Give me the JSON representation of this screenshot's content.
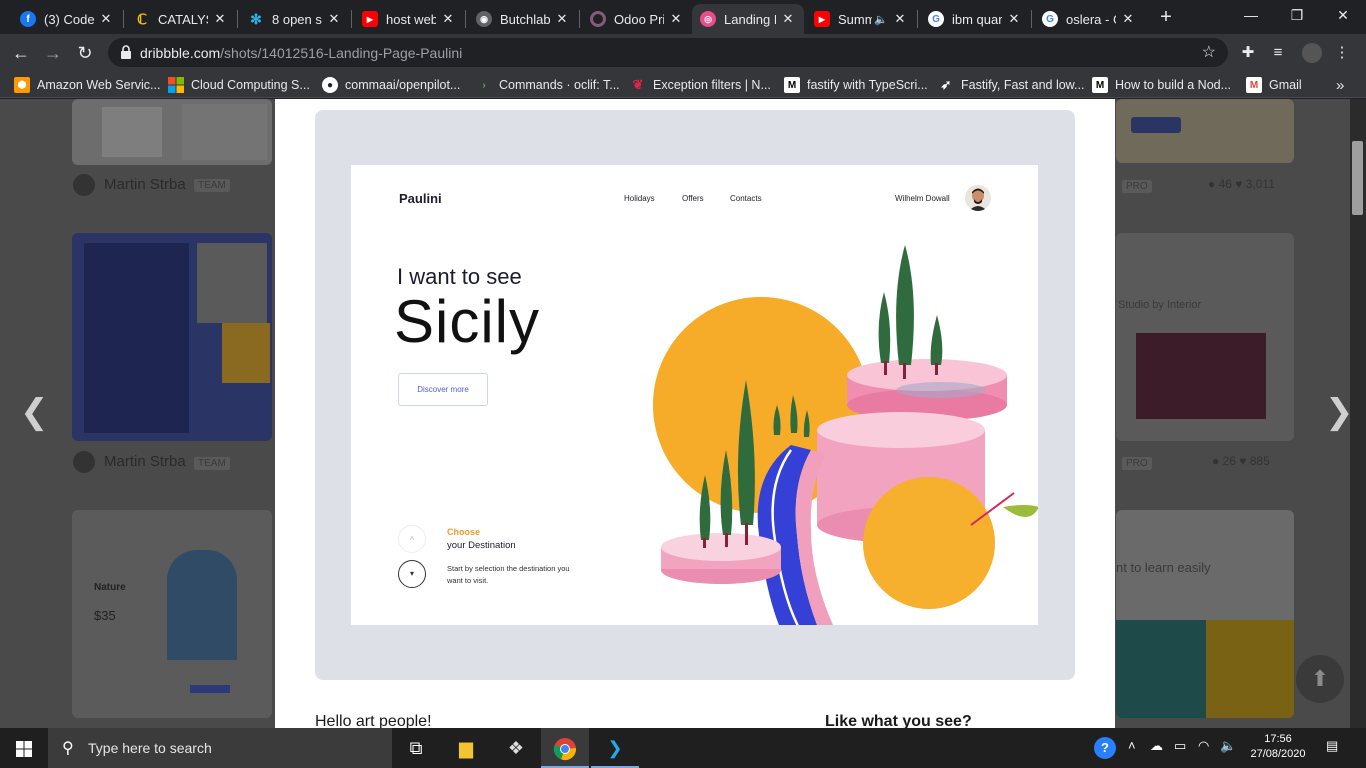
{
  "browser": {
    "tabs": [
      {
        "title": "(3) Codel",
        "icon": "facebook-icon",
        "color": "#1877f2",
        "glyph": "f"
      },
      {
        "title": "CATALYST",
        "icon": "catalyst-icon",
        "color": "#f4c20d",
        "glyph": "C"
      },
      {
        "title": "8 open sc",
        "icon": "snowflake-icon",
        "color": "#29b5e8",
        "glyph": "✻"
      },
      {
        "title": "host web",
        "icon": "youtube-icon",
        "color": "#ff0000",
        "glyph": "▶"
      },
      {
        "title": "Butchlab",
        "icon": "globe-icon",
        "color": "#5f6368",
        "glyph": "◉"
      },
      {
        "title": "Odoo Pri",
        "icon": "odoo-icon",
        "color": "#875a7b",
        "glyph": "o"
      },
      {
        "title": "Landing P",
        "icon": "dribbble-icon",
        "color": "#ea4c89",
        "glyph": "◎"
      },
      {
        "title": "Summ",
        "icon": "youtube-icon",
        "color": "#ff0000",
        "glyph": "▶"
      },
      {
        "title": "ibm quan",
        "icon": "google-icon",
        "color": "#4285f4",
        "glyph": "G"
      },
      {
        "title": "oslera - G",
        "icon": "google-icon",
        "color": "#4285f4",
        "glyph": "G"
      }
    ],
    "url_domain": "dribbble.com",
    "url_path": "/shots/14012516-Landing-Page-Paulini",
    "bookmarks": [
      {
        "label": "Amazon Web Servic...",
        "icon": "aws-icon",
        "color": "#ff9900"
      },
      {
        "label": "Cloud Computing S...",
        "icon": "microsoft-icon",
        "color": "#00a4ef"
      },
      {
        "label": "commaai/openpilot...",
        "icon": "github-icon",
        "color": "#ffffff"
      },
      {
        "label": "Commands · oclif: T...",
        "icon": "oclif-icon",
        "color": "#4caf50"
      },
      {
        "label": "Exception filters | N...",
        "icon": "nestjs-icon",
        "color": "#e0234e"
      },
      {
        "label": "fastify with TypeScri...",
        "icon": "medium-icon",
        "color": "#ffffff"
      },
      {
        "label": "Fastify, Fast and low...",
        "icon": "fastify-icon",
        "color": "#ffffff"
      },
      {
        "label": "How to build a Nod...",
        "icon": "medium-icon",
        "color": "#ffffff"
      },
      {
        "label": "Gmail",
        "icon": "gmail-icon",
        "color": "#ea4335"
      }
    ],
    "bookmarks_more": "»"
  },
  "background": {
    "author_1": "Martin Strba",
    "author_1_badge": "TEAM",
    "author_2": "Martin Strba",
    "author_2_badge": "TEAM",
    "pro_badge": "PRO",
    "stats_1": {
      "comments": "46",
      "likes": "3,011"
    },
    "stats_2": {
      "comments": "26",
      "likes": "885"
    },
    "card_texts": {
      "nature": "Nature",
      "price": "$35",
      "learn": "nt to learn easily",
      "studio": "Studio by Interior"
    }
  },
  "shot": {
    "logo": "Paulini",
    "nav": [
      "Holidays",
      "Offers",
      "Contacts"
    ],
    "user": "Wilhelm Dowall",
    "headline_small": "I want to see",
    "headline_big": "Sicily",
    "cta": "Discover more",
    "choose": "Choose",
    "destination": "your Destination",
    "hint": "Start by selection the destination you want to visit.",
    "colors": {
      "accent_orange": "#f5a623",
      "accent_blue": "#3440d6",
      "accent_pink": "#f4a8c0",
      "tree_green": "#3f6b2f"
    }
  },
  "modal": {
    "greeting": "Hello art people!",
    "like_what": "Like what you see?"
  },
  "taskbar": {
    "search_placeholder": "Type here to search",
    "time": "17:56",
    "date": "27/08/2020"
  }
}
